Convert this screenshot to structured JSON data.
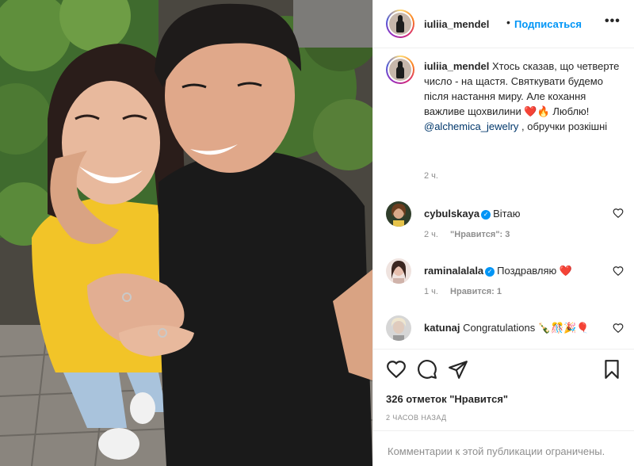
{
  "post": {
    "author": "iuliia_mendel",
    "dot": "•",
    "follow_label": "Подписаться",
    "more_icon": "more-horizontal-icon",
    "more_glyph": "•••"
  },
  "caption": {
    "author": "iuliia_mendel",
    "text_1": "Хтось сказав, що четверте число - на щастя. Святкувати будемо після настання миру. Але кохання важливе щохвилини ",
    "emoji": "❤️🔥",
    "text_2": " Люблю! ",
    "mention": "@alchemica_jewelry",
    "text_3": " , обручки розкішні",
    "time": "2 ч."
  },
  "comments": [
    {
      "author": "cybulskaya",
      "verified": true,
      "text": "Вітаю",
      "time": "2 ч.",
      "likes": "\"Нравится\": 3"
    },
    {
      "author": "raminalalala",
      "verified": true,
      "text": "Поздравляю ❤️",
      "time": "1 ч.",
      "likes": "Нравится: 1"
    },
    {
      "author": "katunaj",
      "verified": false,
      "text": "Congratulations 🍾🎊🎉🎈"
    }
  ],
  "actions": {
    "icons": [
      "heart-icon",
      "comment-icon",
      "share-icon",
      "bookmark-icon"
    ]
  },
  "likes_count": "326 отметок \"Нравится\"",
  "posted_ago": "2 ЧАСОВ НАЗАД",
  "comments_limited": "Комментарии к этой публикации ограничены.",
  "colors": {
    "link_blue": "#0095f6",
    "mention_blue": "#00376b",
    "secondary_text": "#8e8e8e",
    "divider": "#efefef",
    "shirt_yellow": "#f2c428",
    "tshirt_black": "#1a1a1a"
  }
}
